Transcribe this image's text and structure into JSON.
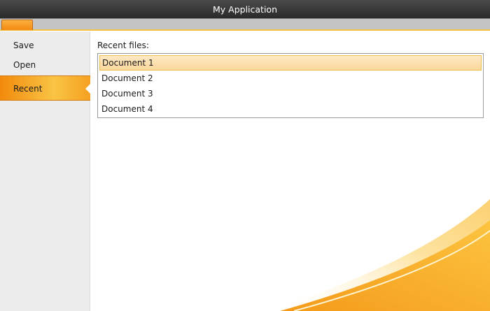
{
  "window": {
    "title": "My Application"
  },
  "sidebar": {
    "items": [
      {
        "label": "Save"
      },
      {
        "label": "Open"
      },
      {
        "label": "Recent"
      }
    ]
  },
  "main": {
    "label": "Recent files:",
    "files": [
      "Document 1",
      "Document 2",
      "Document 3",
      "Document 4"
    ],
    "selected": "Document 1"
  },
  "colors": {
    "accent": "#f7a21b",
    "title_bg": "#333333"
  }
}
